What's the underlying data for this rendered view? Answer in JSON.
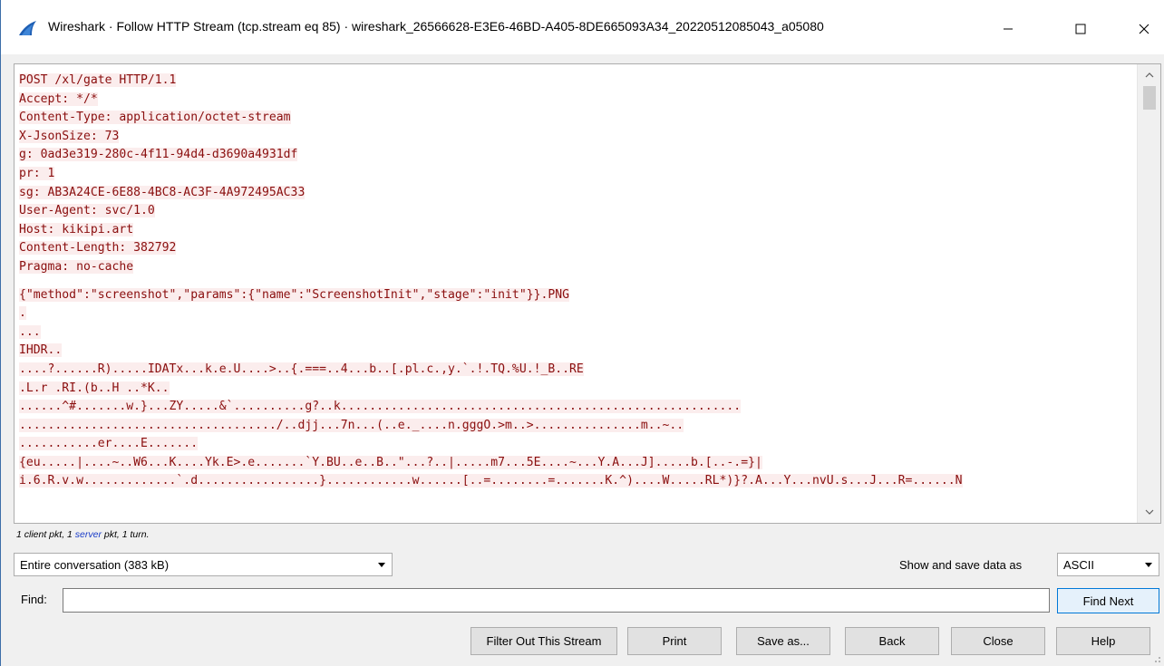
{
  "window": {
    "title": "Wireshark · Follow HTTP Stream (tcp.stream eq 85) · wireshark_26566628-E3E6-46BD-A405-8DE665093A34_20220512085043_a05080",
    "minimize_icon": "minimize-icon",
    "maximize_icon": "maximize-icon",
    "close_icon": "close-icon"
  },
  "stream": {
    "lines": [
      "POST /xl/gate HTTP/1.1",
      "Accept: */*",
      "Content-Type: application/octet-stream",
      "X-JsonSize: 73",
      "g: 0ad3e319-280c-4f11-94d4-d3690a4931df",
      "pr: 1",
      "sg: AB3A24CE-6E88-4BC8-AC3F-4A972495AC33",
      "User-Agent: svc/1.0",
      "Host: kikipi.art",
      "Content-Length: 382792",
      "Pragma: no-cache",
      "",
      "{\"method\":\"screenshot\",\"params\":{\"name\":\"ScreenshotInit\",\"stage\":\"init\"}}.PNG",
      ".",
      "...",
      "IHDR..",
      "....?......R).....IDATx...k.e.U....>..{.===..4...b..[.pl.c.,y.`.!.TQ.%U.!_B..RE",
      ".L.r .RI.(b..H ..*K..",
      "......^#.......w.}...ZY.....&`..........g?..k........................................................",
      "..................................../..djj...7n...(..e._....n.gggO.>m..>...............m..~..",
      "...........er....E.......",
      "{eu.....|....~..W6...K....Yk.E>.e.......`Y.BU..e..B..\"...?..|.....m7...5E....~...Y.A...J].....b.[..-.=}|",
      "i.6.R.v.w.............`.d.................}............w......[..=........=.......K.^)....W.....RL*)}?.A...Y...nvU.s...J...R=......N"
    ],
    "text_color": "#8a0e0e",
    "highlight_color": "#fbeded"
  },
  "status": {
    "prefix": "1 client pkt, 1 ",
    "server_word": "server",
    "suffix": " pkt, 1 turn."
  },
  "controls": {
    "conversation_value": "Entire conversation (383 kB)",
    "save_label": "Show and save data as",
    "format_value": "ASCII",
    "find_label": "Find:",
    "find_value": "",
    "find_next_label": "Find Next"
  },
  "buttons": {
    "filter_out": "Filter Out This Stream",
    "print": "Print",
    "save_as": "Save as...",
    "back": "Back",
    "close": "Close",
    "help": "Help"
  }
}
